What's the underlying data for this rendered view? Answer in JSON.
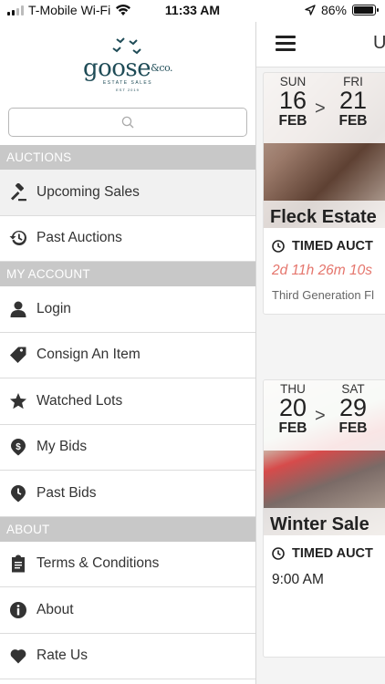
{
  "status_bar": {
    "carrier": "T-Mobile Wi-Fi",
    "time": "11:33 AM",
    "battery": "86%",
    "battery_level": 0.86
  },
  "logo": {
    "word": "goose",
    "mark": "&co.",
    "sub": "ESTATE SALES",
    "est": "EST 2019"
  },
  "search": {
    "placeholder": ""
  },
  "sidebar": {
    "sections": [
      {
        "title": "AUCTIONS",
        "items": [
          {
            "label": "Upcoming Sales",
            "icon": "gavel-icon"
          },
          {
            "label": "Past Auctions",
            "icon": "history-icon"
          }
        ]
      },
      {
        "title": "MY ACCOUNT",
        "items": [
          {
            "label": "Login",
            "icon": "user-icon"
          },
          {
            "label": "Consign An Item",
            "icon": "tag-icon"
          },
          {
            "label": "Watched Lots",
            "icon": "star-icon"
          },
          {
            "label": "My Bids",
            "icon": "dollar-pin-icon"
          },
          {
            "label": "Past Bids",
            "icon": "clock-pin-icon"
          }
        ]
      },
      {
        "title": "ABOUT",
        "items": [
          {
            "label": "Terms & Conditions",
            "icon": "clipboard-icon"
          },
          {
            "label": "About",
            "icon": "info-icon"
          },
          {
            "label": "Rate Us",
            "icon": "heart-icon"
          }
        ]
      }
    ]
  },
  "main": {
    "topbar_glyph": "U",
    "cards": [
      {
        "from": {
          "dow": "SUN",
          "day": "16",
          "mon": "FEB"
        },
        "to": {
          "dow": "FRI",
          "day": "21",
          "mon": "FEB"
        },
        "arrow": ">",
        "title": "Fleck Estate",
        "type": "TIMED AUCT",
        "countdown": "2d 11h 26m 10s",
        "subtitle": "Third Generation Fl"
      },
      {
        "from": {
          "dow": "THU",
          "day": "20",
          "mon": "FEB"
        },
        "to": {
          "dow": "SAT",
          "day": "29",
          "mon": "FEB"
        },
        "arrow": ">",
        "title": "Winter Sale",
        "type": "TIMED AUCT",
        "start_time": "9:00 AM"
      }
    ]
  }
}
